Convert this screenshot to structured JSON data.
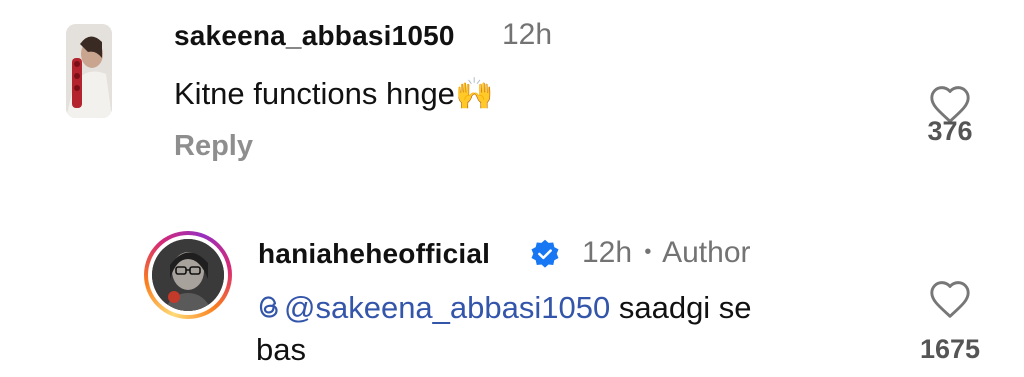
{
  "comments": [
    {
      "username": "sakeena_abbasi1050",
      "time": "12h",
      "text": "Kitne functions hnge",
      "emoji": "🙌",
      "reply_label": "Reply",
      "likes": "376"
    },
    {
      "username": "haniaheheofficial",
      "time": "12h",
      "separator": "•",
      "author_label": "Author",
      "mention": "@sakeena_abbasi1050",
      "text_line1": " saadgi se",
      "text_line2": "bas",
      "likes": "1675"
    }
  ],
  "icons": {
    "like": "heart-outline-icon",
    "verified": "verified-badge-icon",
    "threads": "threads-icon"
  },
  "colors": {
    "mention": "#3355aa",
    "verified": "#1877f2",
    "meta_text": "#737373"
  }
}
